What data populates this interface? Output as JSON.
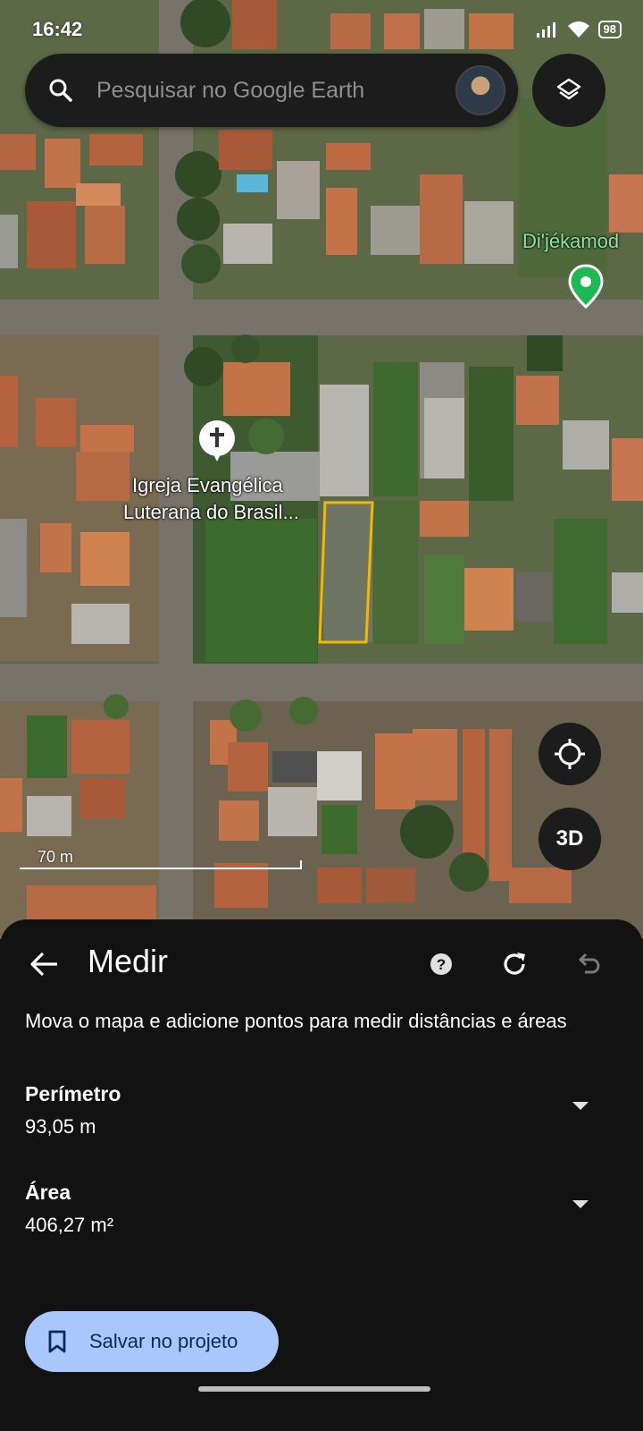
{
  "status_bar": {
    "time": "16:42",
    "battery": "98"
  },
  "search": {
    "placeholder": "Pesquisar no Google Earth"
  },
  "map": {
    "place_label": "Di'jékamod",
    "church_label_line1": "Igreja Evangélica",
    "church_label_line2": "Luterana do Brasil...",
    "scale_label": "70 m",
    "three_d_label": "3D"
  },
  "measure": {
    "title": "Medir",
    "description": "Mova o mapa e adicione pontos para medir distâncias e áreas",
    "perimeter_label": "Perímetro",
    "perimeter_value": "93,05 m",
    "area_label": "Área",
    "area_value": "406,27 m²",
    "save_label": "Salvar no projeto"
  },
  "colors": {
    "sheet_bg": "#121212",
    "save_button_bg": "#a9c7fa",
    "polygon_outline": "#f2b705",
    "place_pin": "#1db954"
  },
  "icons": [
    "search-icon",
    "layers-icon",
    "cross-pin-icon",
    "location-pin-icon",
    "my-location-icon",
    "back-arrow-icon",
    "help-icon",
    "reset-icon",
    "undo-icon",
    "chevron-down-icon",
    "bookmark-icon",
    "wifi-icon",
    "signal-icon"
  ]
}
